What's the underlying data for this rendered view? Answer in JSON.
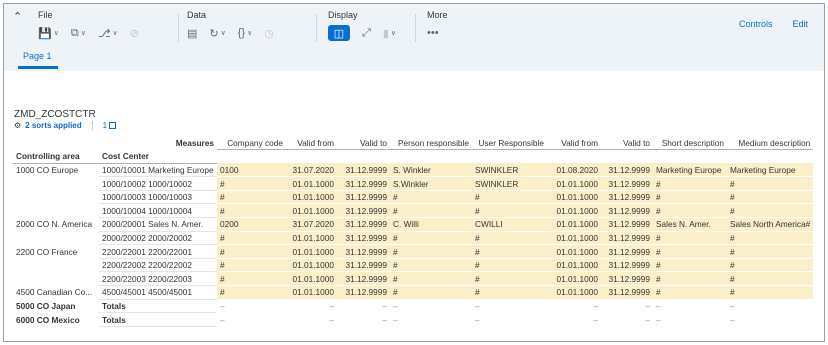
{
  "toolbar": {
    "groups": {
      "file": "File",
      "data": "Data",
      "display": "Display",
      "more": "More"
    },
    "more_icon": "•••",
    "controls_label": "Controls",
    "edit_label": "Edit"
  },
  "page_tab": "Page 1",
  "table_name": "ZMD_ZCOSTCTR",
  "sorts_label": "2 sorts applied",
  "count_label": "1",
  "table": {
    "measures_label": "Measures",
    "dim_headers": [
      "Controlling area",
      "Cost Center"
    ],
    "columns": [
      "Company code",
      "Valid from",
      "Valid to",
      "Person responsible",
      "User Responsible",
      "Valid from",
      "Valid to",
      "Short description",
      "Medium description"
    ],
    "rows": [
      {
        "ca": "1000 CO Europe",
        "cc": "1000/10001 Marketing Europe",
        "v": [
          "0100",
          "31.07.2020",
          "31.12.9999",
          "S. Winkler",
          "SWINKLER",
          "01.08.2020",
          "31.12.9999",
          "Marketing Europe",
          "Marketing Europe"
        ]
      },
      {
        "ca": "",
        "cc": "1000/10002 1000/10002",
        "v": [
          "#",
          "01.01.1000",
          "31.12.9999",
          "S.Winkler",
          "SWINKLER",
          "01.01.1000",
          "31.12.9999",
          "#",
          "#"
        ]
      },
      {
        "ca": "",
        "cc": "1000/10003 1000/10003",
        "v": [
          "#",
          "01.01.1000",
          "31.12.9999",
          "#",
          "#",
          "01.01.1000",
          "31.12.9999",
          "#",
          "#"
        ]
      },
      {
        "ca": "",
        "cc": "1000/10004 1000/10004",
        "v": [
          "#",
          "01.01.1000",
          "31.12.9999",
          "#",
          "#",
          "01.01.1000",
          "31.12.9999",
          "#",
          "#"
        ]
      },
      {
        "ca": "2000 CO N. America",
        "cc": "2000/20001 Sales N. Amer.",
        "v": [
          "0200",
          "31.07.2020",
          "31.12.9999",
          "C. Willi",
          "CWILLI",
          "01.01.1000",
          "31.12.9999",
          "Sales N. Amer.",
          "Sales North America#"
        ]
      },
      {
        "ca": "",
        "cc": "2000/20002 2000/20002",
        "v": [
          "#",
          "01.01.1000",
          "31.12.9999",
          "#",
          "#",
          "01.01.1000",
          "31.12.9999",
          "#",
          "#"
        ]
      },
      {
        "ca": "2200 CO France",
        "cc": "2200/22001 2200/22001",
        "v": [
          "#",
          "01.01.1000",
          "31.12.9999",
          "#",
          "#",
          "01.01.1000",
          "31.12.9999",
          "#",
          "#"
        ]
      },
      {
        "ca": "",
        "cc": "2200/22002 2200/22002",
        "v": [
          "#",
          "01.01.1000",
          "31.12.9999",
          "#",
          "#",
          "01.01.1000",
          "31.12.9999",
          "#",
          "#"
        ]
      },
      {
        "ca": "",
        "cc": "2200/22003 2200/22003",
        "v": [
          "#",
          "01.01.1000",
          "31.12.9999",
          "#",
          "#",
          "01.01.1000",
          "31.12.9999",
          "#",
          "#"
        ]
      },
      {
        "ca": "4500 Canadian Co...",
        "cc": "4500/45001 4500/45001",
        "v": [
          "#",
          "01.01.1000",
          "31.12.9999",
          "#",
          "#",
          "01.01.1000",
          "31.12.9999",
          "#",
          "#"
        ]
      }
    ],
    "totals": [
      {
        "ca": "5000 CO Japan",
        "cc": "Totals",
        "v": [
          "–",
          "–",
          "–",
          "–",
          "–",
          "–",
          "–",
          "–",
          "–"
        ]
      },
      {
        "ca": "6000 CO Mexico",
        "cc": "Totals",
        "v": [
          "–",
          "–",
          "–",
          "–",
          "–",
          "–",
          "–",
          "–",
          "–"
        ]
      }
    ]
  },
  "colors": {
    "accent": "#0a6ed1",
    "highlight": "#fbefc9",
    "toolbar_bg": "#eef3f8"
  }
}
